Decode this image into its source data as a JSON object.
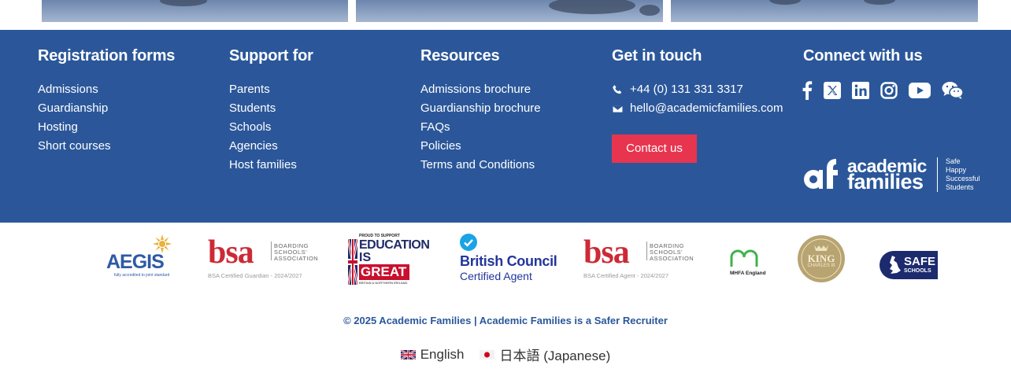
{
  "footer": {
    "columns": [
      {
        "heading": "Registration forms",
        "links": [
          "Admissions",
          "Guardianship",
          "Hosting",
          "Short courses"
        ]
      },
      {
        "heading": "Support for",
        "links": [
          "Parents",
          "Students",
          "Schools",
          "Agencies",
          "Host families"
        ]
      },
      {
        "heading": "Resources",
        "links": [
          "Admissions brochure",
          "Guardianship brochure",
          "FAQs",
          "Policies",
          "Terms and Conditions"
        ]
      }
    ],
    "contact": {
      "heading": "Get in touch",
      "phone": "+44 (0) 131 331 3317",
      "email": "hello@academicfamilies.com",
      "button": "Contact us"
    },
    "connect": {
      "heading": "Connect with us",
      "icons": [
        "facebook-icon",
        "x-icon",
        "linkedin-icon",
        "instagram-icon",
        "youtube-icon",
        "wechat-icon"
      ]
    },
    "brand": {
      "line1": "academic",
      "line2": "families",
      "tagline": [
        "Safe",
        "Happy",
        "Successful",
        "Students"
      ]
    },
    "colors": {
      "footer_bg": "#2b579a",
      "accent": "#e8354f"
    }
  },
  "logos": {
    "aegis": {
      "name": "AEGIS",
      "caption": "fully accredited to joint standard"
    },
    "bsa_guardian": {
      "mark": "bsa",
      "line1": "BOARDING",
      "line2": "SCHOOLS'",
      "line3": "ASSOCIATION",
      "caption": "BSA Certified Guardian - 2024/2027"
    },
    "education_great": {
      "top": "PROUD TO SUPPORT",
      "line1": "EDUCATION",
      "line2": "IS",
      "line3": "GREAT",
      "bottom": "BRITAIN & NORTHERN IRELAND"
    },
    "british_council": {
      "line1": "British Council",
      "line2": "Certified Agent"
    },
    "bsa_agent": {
      "mark": "bsa",
      "line1": "BOARDING",
      "line2": "SCHOOLS'",
      "line3": "ASSOCIATION",
      "caption": "BSA Certified Agent - 2024/2027"
    },
    "mhfa": {
      "name": "MHFA England"
    },
    "king": {
      "name": "KING",
      "line2": "CHARLES III"
    },
    "safe_schools": {
      "line1": "SAFE",
      "line2": "SCHOOLS"
    }
  },
  "copyright": "© 2025 Academic Families | Academic Families is a Safer Recruiter",
  "languages": [
    {
      "label": "English"
    },
    {
      "label": "日本語 (Japanese)"
    }
  ]
}
